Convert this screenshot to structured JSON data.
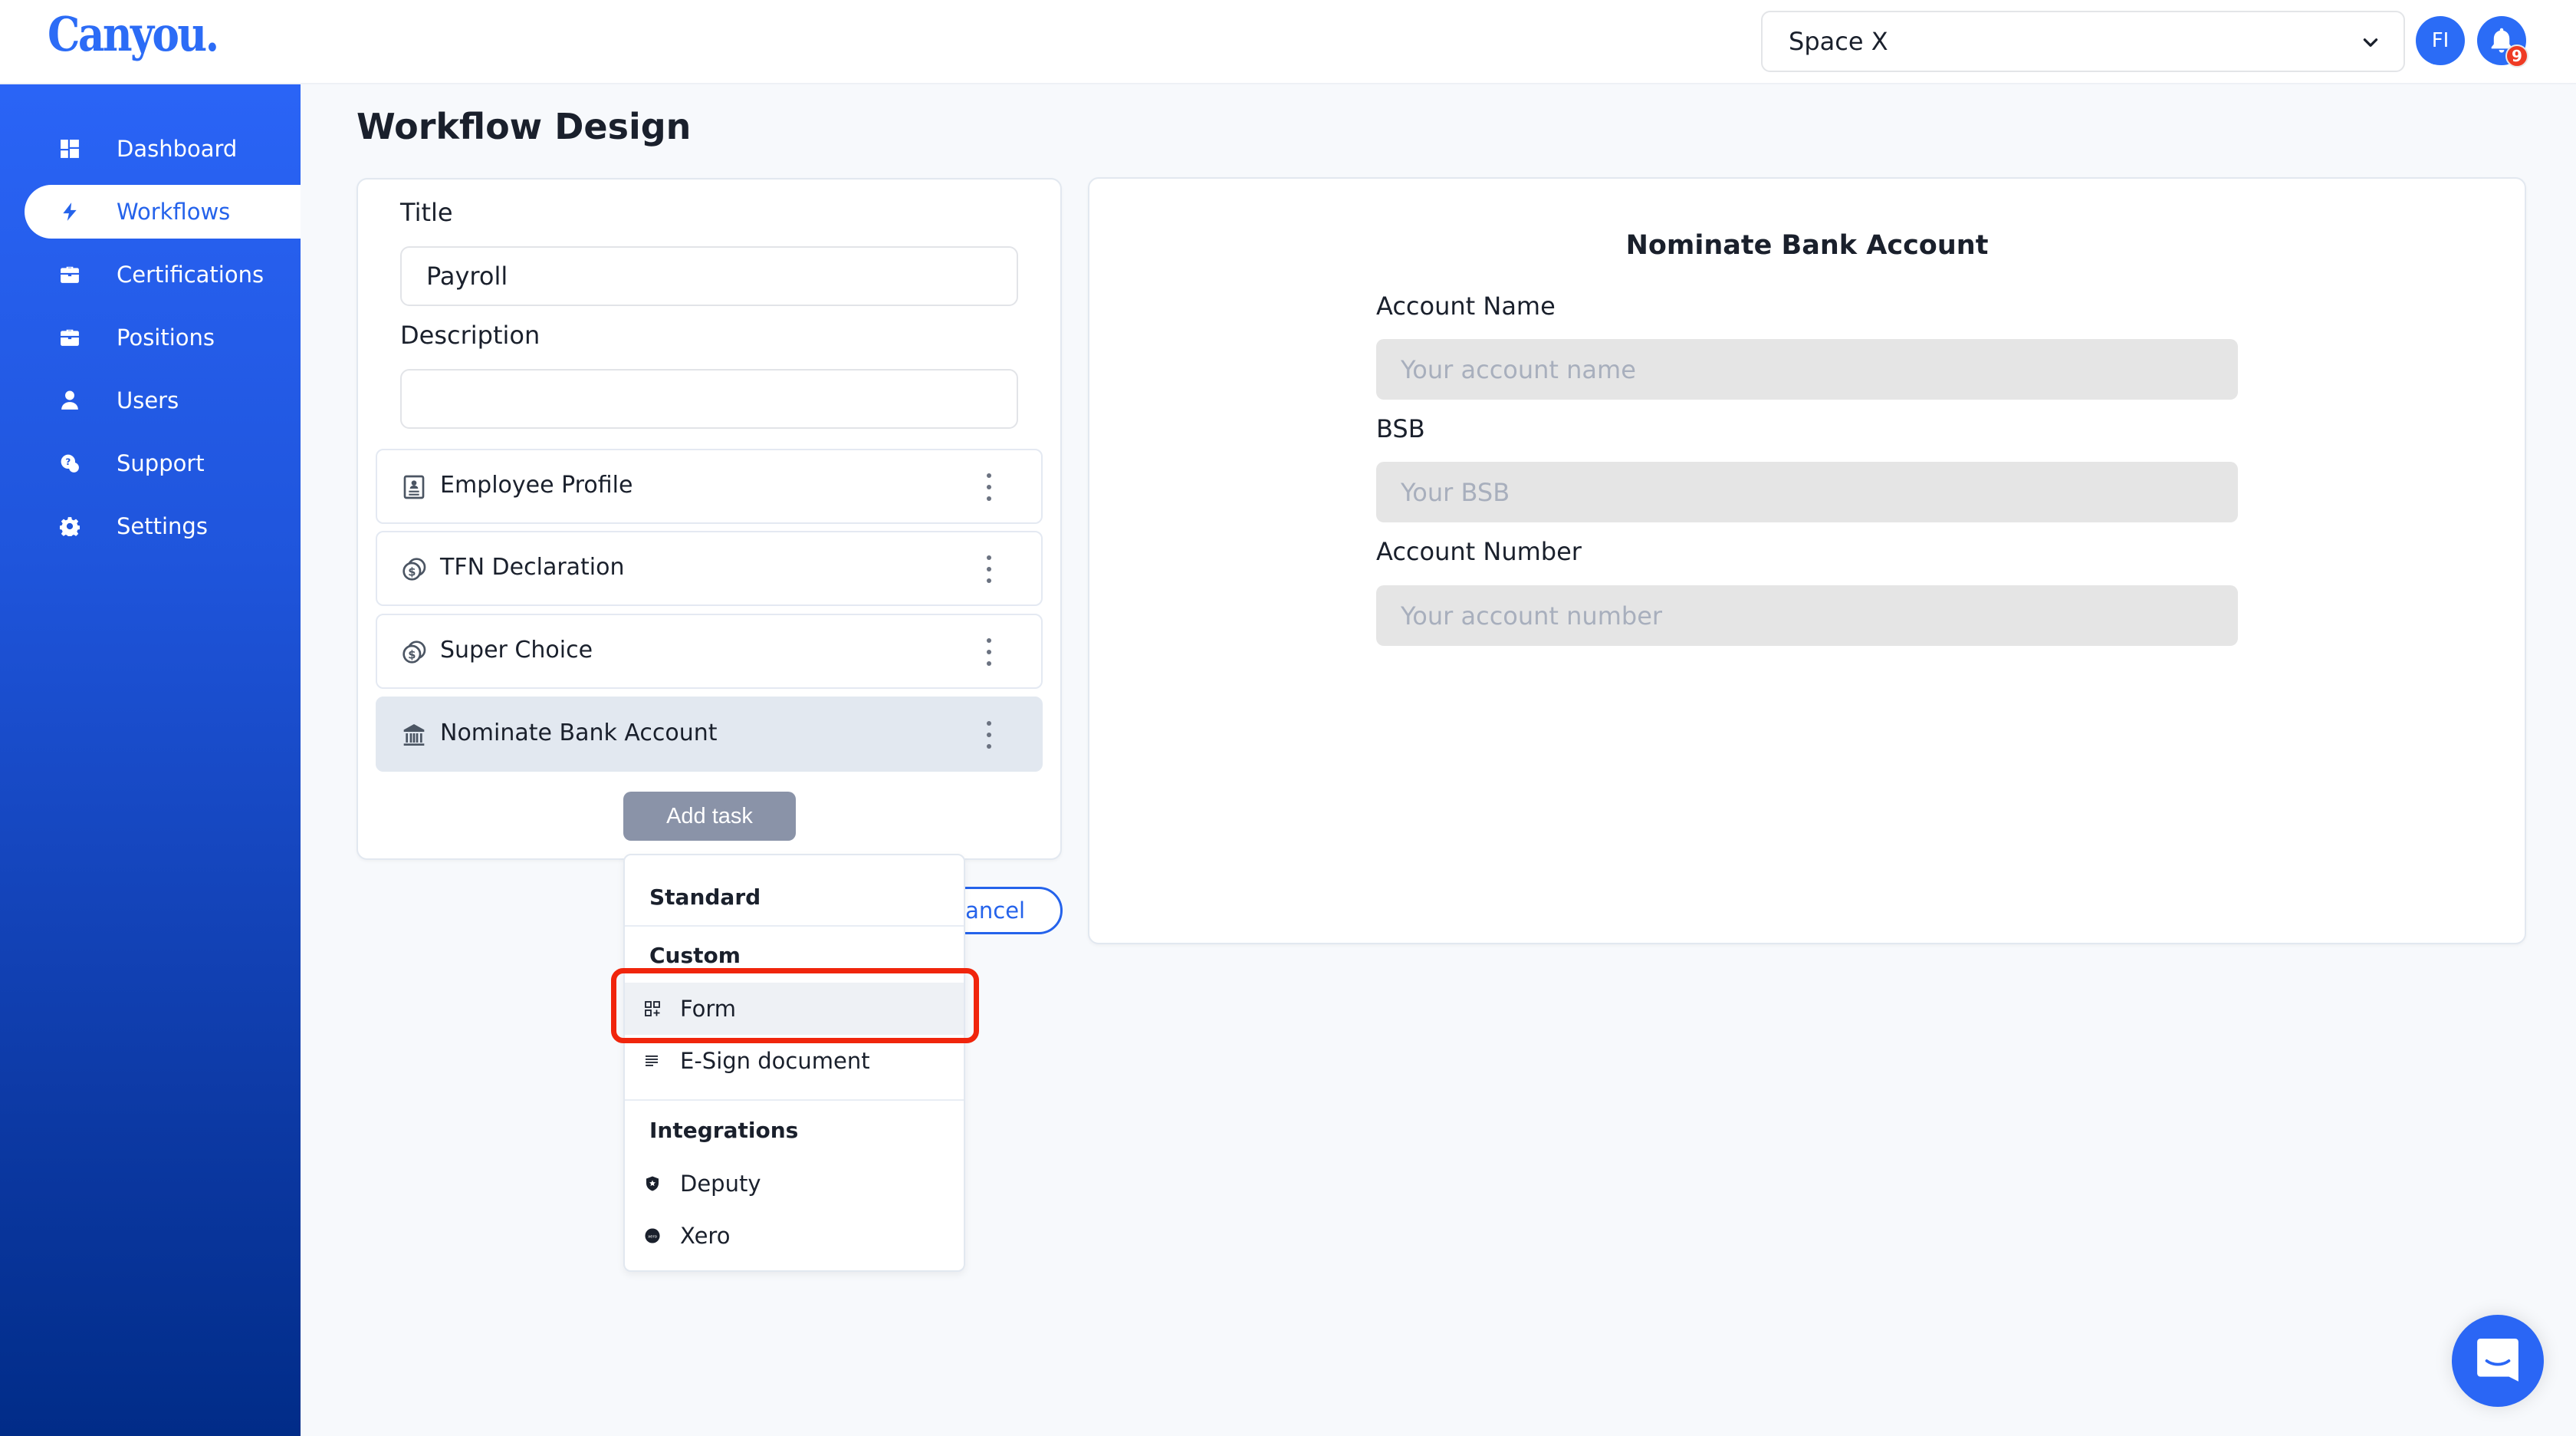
{
  "header": {
    "logo": "Canyou.",
    "space_selector": {
      "value": "Space X"
    },
    "avatar_initials": "FI",
    "notifications_count": "9"
  },
  "sidebar": {
    "items": [
      {
        "label": "Dashboard",
        "icon": "dashboard-icon",
        "active": false
      },
      {
        "label": "Workflows",
        "icon": "lightning-icon",
        "active": true
      },
      {
        "label": "Certifications",
        "icon": "briefcase-icon",
        "active": false
      },
      {
        "label": "Positions",
        "icon": "briefcase-icon",
        "active": false
      },
      {
        "label": "Users",
        "icon": "user-icon",
        "active": false
      },
      {
        "label": "Support",
        "icon": "support-chat-icon",
        "active": false
      },
      {
        "label": "Settings",
        "icon": "gear-icon",
        "active": false
      }
    ]
  },
  "page": {
    "title": "Workflow Design"
  },
  "workflow": {
    "title_label": "Title",
    "title_value": "Payroll",
    "description_label": "Description",
    "description_value": "",
    "tasks": [
      {
        "label": "Employee Profile",
        "icon": "profile-card-icon",
        "selected": false
      },
      {
        "label": "TFN Declaration",
        "icon": "coins-icon",
        "selected": false
      },
      {
        "label": "Super Choice",
        "icon": "coins-icon",
        "selected": false
      },
      {
        "label": "Nominate Bank Account",
        "icon": "bank-icon",
        "selected": true
      }
    ],
    "add_task_label": "Add task",
    "cancel_label": "Cancel"
  },
  "add_task_menu": {
    "sections": [
      {
        "title": "Standard",
        "items": []
      },
      {
        "title": "Custom",
        "items": [
          {
            "label": "Form",
            "icon": "form-grid-icon",
            "highlighted": true
          },
          {
            "label": "E-Sign document",
            "icon": "lines-icon",
            "highlighted": false
          }
        ]
      },
      {
        "title": "Integrations",
        "items": [
          {
            "label": "Deputy",
            "icon": "deputy-shield-icon",
            "highlighted": false
          },
          {
            "label": "Xero",
            "icon": "xero-icon",
            "highlighted": false
          }
        ]
      }
    ]
  },
  "preview": {
    "title": "Nominate Bank Account",
    "fields": [
      {
        "label": "Account Name",
        "placeholder": "Your account name",
        "value": ""
      },
      {
        "label": "BSB",
        "placeholder": "Your BSB",
        "value": ""
      },
      {
        "label": "Account Number",
        "placeholder": "Your account number",
        "value": ""
      }
    ]
  },
  "colors": {
    "brand": "#2563eb",
    "highlight": "#f0250c",
    "selected_task_bg": "#e2e8f0",
    "add_task_bg": "#8a93a8"
  }
}
